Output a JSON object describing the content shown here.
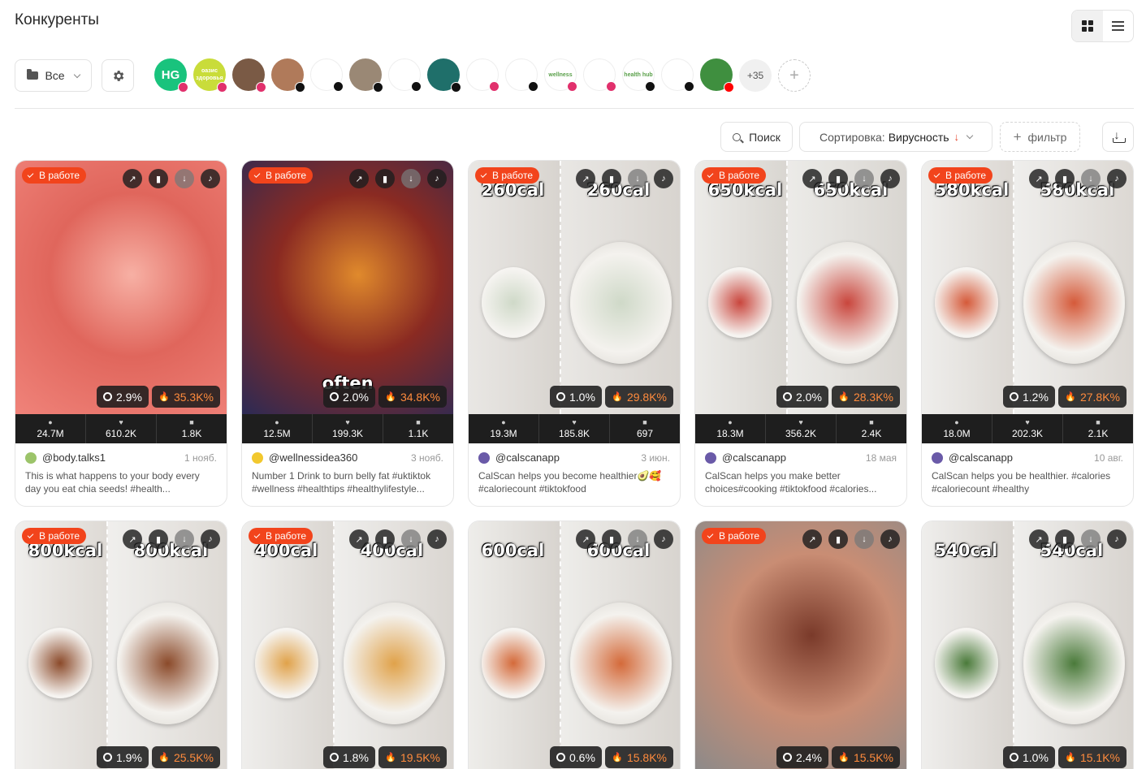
{
  "page": {
    "title": "Конкуренты"
  },
  "toolbar": {
    "folder_label": "Все",
    "more_count": "+35",
    "add_symbol": "+",
    "search_label": "Поиск",
    "sort_label": "Сортировка:",
    "sort_value": "Вирусность",
    "sort_direction_icon": "↓",
    "filter_label": "фильтр"
  },
  "competitors": [
    {
      "text": "HG",
      "color": "#19c37d",
      "platform": "ig"
    },
    {
      "text": "оазис здоровья",
      "color": "#c9dc3a",
      "platform": "ig"
    },
    {
      "text": "",
      "color": "#7a5a45",
      "platform": "ig"
    },
    {
      "text": "",
      "color": "#b07a5a",
      "platform": "tt"
    },
    {
      "text": "",
      "color": "#ffffff",
      "platform": "tt"
    },
    {
      "text": "",
      "color": "#9a8875",
      "platform": "tt"
    },
    {
      "text": "",
      "color": "#ffffff",
      "platform": "tt"
    },
    {
      "text": "",
      "color": "#1f6f6a",
      "platform": "tt"
    },
    {
      "text": "",
      "color": "#ffffff",
      "platform": "ig"
    },
    {
      "text": "",
      "color": "#ffffff",
      "platform": "tt"
    },
    {
      "text": "wellness",
      "color": "#ffffff",
      "platform": "ig"
    },
    {
      "text": "",
      "color": "#ffffff",
      "platform": "ig"
    },
    {
      "text": "health hub",
      "color": "#ffffff",
      "platform": "tt"
    },
    {
      "text": "",
      "color": "#ffffff",
      "platform": "tt"
    },
    {
      "text": "",
      "color": "#3f8f3f",
      "platform": "yt"
    }
  ],
  "status_label": "В работе",
  "icons": [
    "grid-view-icon",
    "list-view-icon",
    "folder-icon",
    "chevron-down-icon",
    "gear-icon",
    "search-icon",
    "download-icon",
    "external-link-icon",
    "bookmark-icon",
    "tiktok-icon",
    "eye-icon",
    "heart-icon",
    "comment-icon",
    "flame-icon",
    "engagement-icon"
  ],
  "cards": [
    {
      "in_work": true,
      "er": "2.9%",
      "virality": "35.3K%",
      "views": "24.7M",
      "likes": "610.2K",
      "comments": "1.8K",
      "author": "@body.talks1",
      "date": "1 нояб.",
      "desc": "This is what happens to your body every day you eat chia seeds! #health...",
      "overlay_left": "",
      "overlay_right": "",
      "colors": [
        "#f0837a",
        "#e0665c",
        "#f7b0a4"
      ]
    },
    {
      "in_work": true,
      "er": "2.0%",
      "virality": "34.8K%",
      "views": "12.5M",
      "likes": "199.3K",
      "comments": "1.1K",
      "author": "@wellnessidea360",
      "date": "3 нояб.",
      "desc": "Number 1 Drink to burn belly fat #uktiktok #wellness #healthtips #healthylifestyle...",
      "overlay_left": "often",
      "overlay_right": "",
      "colors": [
        "#2b2a55",
        "#8a2a22",
        "#e08a2c"
      ]
    },
    {
      "in_work": true,
      "er": "1.0%",
      "virality": "29.8K%",
      "views": "19.3M",
      "likes": "185.8K",
      "comments": "697",
      "author": "@calscanapp",
      "date": "3 июн.",
      "desc": "CalScan helps you become healthier🥑🥰 #caloriecount #tiktokfood",
      "overlay_left": "260cal",
      "overlay_right": "260cal",
      "colors": [
        "#e9e7e4",
        "#d8d4cf",
        "#cfd9c8"
      ]
    },
    {
      "in_work": true,
      "er": "2.0%",
      "virality": "28.3K%",
      "views": "18.3M",
      "likes": "356.2K",
      "comments": "2.4K",
      "author": "@calscanapp",
      "date": "18 мая",
      "desc": "CalScan helps you make better choices#cooking #tiktokfood #calories...",
      "overlay_left": "650kcal",
      "overlay_right": "650kcal",
      "colors": [
        "#ecebe8",
        "#d9d6d1",
        "#c9463d"
      ]
    },
    {
      "in_work": true,
      "er": "1.2%",
      "virality": "27.8K%",
      "views": "18.0M",
      "likes": "202.3K",
      "comments": "2.1K",
      "author": "@calscanapp",
      "date": "10 авг.",
      "desc": "CalScan helps you be healthier. #calories #caloriecount #healthy",
      "overlay_left": "580kcal",
      "overlay_right": "580kcal",
      "colors": [
        "#efeeec",
        "#dcd8d3",
        "#d55a3a"
      ]
    },
    {
      "in_work": true,
      "er": "1.9%",
      "virality": "25.5K%",
      "views": "",
      "likes": "",
      "comments": "",
      "author": "",
      "date": "",
      "desc": "",
      "overlay_left": "800kcal",
      "overlay_right": "800kcal",
      "colors": [
        "#f0efed",
        "#dedad5",
        "#8b4a2a"
      ]
    },
    {
      "in_work": true,
      "er": "1.8%",
      "virality": "19.5K%",
      "views": "",
      "likes": "",
      "comments": "",
      "author": "",
      "date": "",
      "desc": "",
      "overlay_left": "400cal",
      "overlay_right": "400cal",
      "colors": [
        "#efeeec",
        "#dad6d1",
        "#e0a24a"
      ]
    },
    {
      "in_work": false,
      "er": "0.6%",
      "virality": "15.8K%",
      "views": "",
      "likes": "",
      "comments": "",
      "author": "",
      "date": "",
      "desc": "",
      "overlay_left": "600cal",
      "overlay_right": "600cal",
      "colors": [
        "#eeedea",
        "#d8d4cf",
        "#d46a3a"
      ]
    },
    {
      "in_work": true,
      "er": "2.4%",
      "virality": "15.5K%",
      "views": "",
      "likes": "",
      "comments": "",
      "author": "",
      "date": "",
      "desc": "",
      "overlay_left": "",
      "overlay_right": "",
      "colors": [
        "#8a8a8a",
        "#c98d74",
        "#7a3a2a"
      ]
    },
    {
      "in_work": false,
      "er": "1.0%",
      "virality": "15.1K%",
      "views": "",
      "likes": "",
      "comments": "",
      "author": "",
      "date": "",
      "desc": "",
      "overlay_left": "540cal",
      "overlay_right": "540cal",
      "colors": [
        "#efeeec",
        "#d8d4cf",
        "#4a7a3a"
      ]
    }
  ]
}
